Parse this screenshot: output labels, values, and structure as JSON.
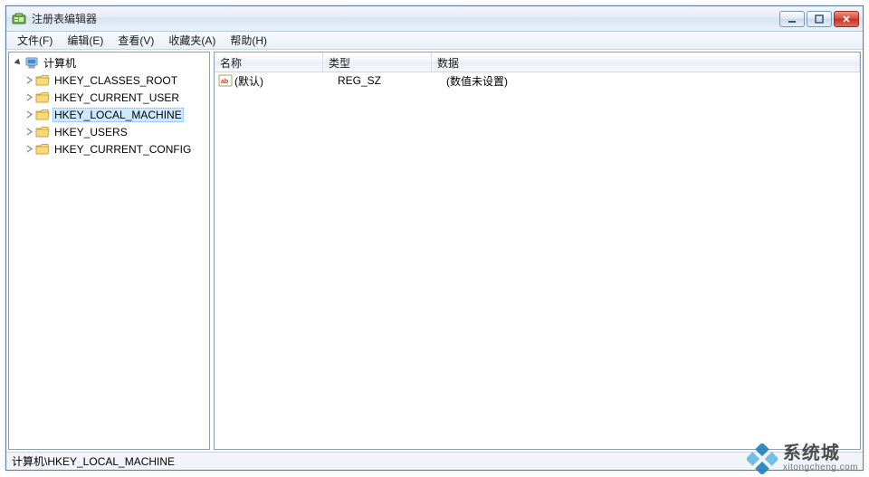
{
  "window": {
    "title": "注册表编辑器"
  },
  "menubar": {
    "items": [
      {
        "label": "文件(F)"
      },
      {
        "label": "编辑(E)"
      },
      {
        "label": "查看(V)"
      },
      {
        "label": "收藏夹(A)"
      },
      {
        "label": "帮助(H)"
      }
    ]
  },
  "tree": {
    "root": {
      "label": "计算机",
      "expanded": true
    },
    "children": [
      {
        "label": "HKEY_CLASSES_ROOT",
        "selected": false
      },
      {
        "label": "HKEY_CURRENT_USER",
        "selected": false
      },
      {
        "label": "HKEY_LOCAL_MACHINE",
        "selected": true
      },
      {
        "label": "HKEY_USERS",
        "selected": false
      },
      {
        "label": "HKEY_CURRENT_CONFIG",
        "selected": false
      }
    ]
  },
  "list": {
    "columns": {
      "name": "名称",
      "type": "类型",
      "data": "数据"
    },
    "rows": [
      {
        "name": "(默认)",
        "type": "REG_SZ",
        "data": "(数值未设置)"
      }
    ]
  },
  "statusbar": {
    "path": "计算机\\HKEY_LOCAL_MACHINE"
  },
  "watermark": {
    "text_big": "系统城",
    "text_small": "xitongcheng.com"
  }
}
